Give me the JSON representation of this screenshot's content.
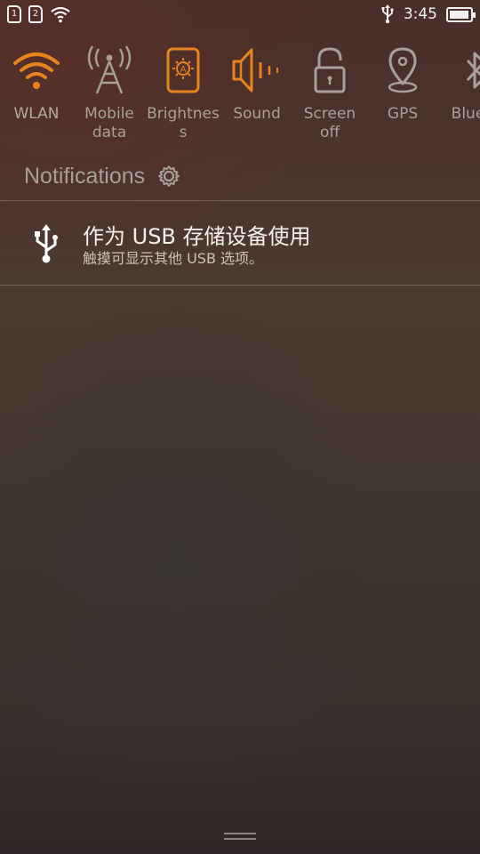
{
  "status_bar": {
    "sim1": "1",
    "sim2": "2",
    "time": "3:45",
    "icons": [
      "sim1-icon",
      "sim2-icon",
      "wifi-icon",
      "usb-icon",
      "battery-icon"
    ]
  },
  "quick_settings": [
    {
      "label_line1": "WLAN",
      "label_line2": "",
      "icon": "wifi-icon",
      "active": true
    },
    {
      "label_line1": "Mobile",
      "label_line2": "data",
      "icon": "cell-tower-icon",
      "active": false
    },
    {
      "label_line1": "Brightnes",
      "label_line2": "s",
      "icon": "brightness-auto-icon",
      "active": true
    },
    {
      "label_line1": "Sound",
      "label_line2": "",
      "icon": "speaker-icon",
      "active": true
    },
    {
      "label_line1": "Screen",
      "label_line2": "off",
      "icon": "lock-icon",
      "active": false
    },
    {
      "label_line1": "GPS",
      "label_line2": "",
      "icon": "location-pin-icon",
      "active": false
    },
    {
      "label_line1": "Blueto",
      "label_line2": "",
      "icon": "bluetooth-icon",
      "active": false
    }
  ],
  "notifications": {
    "header": "Notifications",
    "items": [
      {
        "icon": "usb-icon",
        "title": "作为 USB 存储设备使用",
        "subtitle": "触摸可显示其他 USB 选项。"
      }
    ]
  },
  "colors": {
    "accent_active": "#e8841c",
    "inactive_icon": "#a8a09a"
  }
}
